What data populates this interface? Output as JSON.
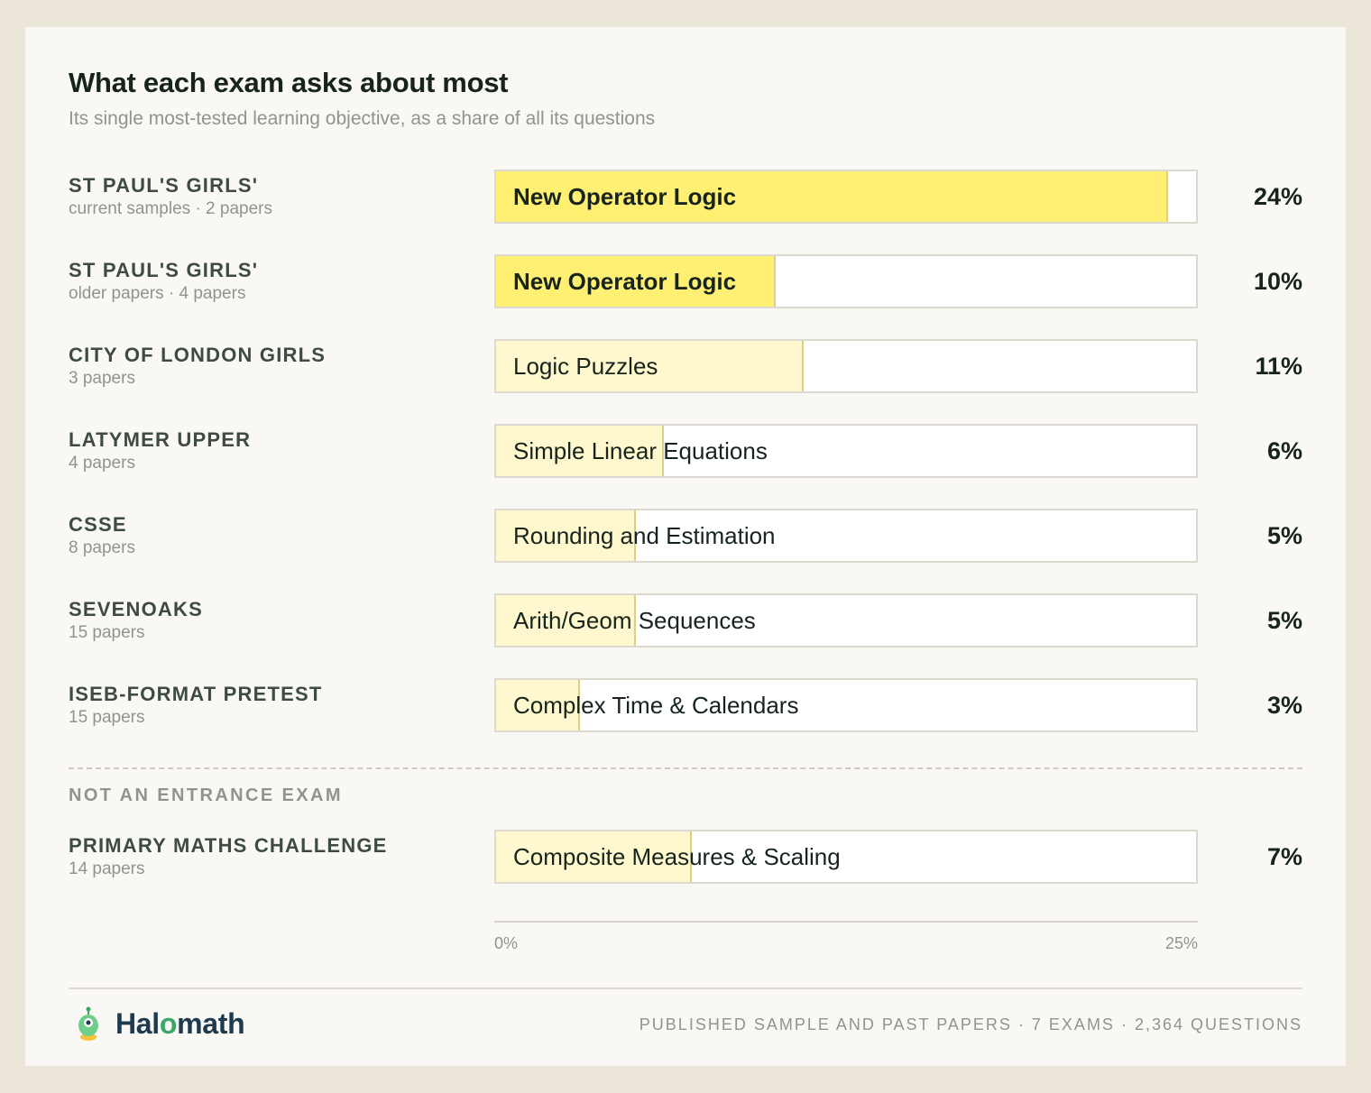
{
  "title": "What each exam asks about most",
  "subtitle": "Its single most-tested learning objective, as a share of all its questions",
  "chart_data": {
    "type": "bar",
    "orientation": "horizontal",
    "xlim": [
      0,
      25
    ],
    "x_ticks": [
      "0%",
      "25%"
    ],
    "rows": [
      {
        "exam": "ST PAUL'S GIRLS'",
        "meta": "current samples · 2 papers",
        "objective": "New Operator Logic",
        "value": 24,
        "label": "24%",
        "highlight": true
      },
      {
        "exam": "ST PAUL'S GIRLS'",
        "meta": "older papers · 4 papers",
        "objective": "New Operator Logic",
        "value": 10,
        "label": "10%",
        "highlight": true
      },
      {
        "exam": "CITY OF LONDON GIRLS",
        "meta": "3 papers",
        "objective": "Logic Puzzles",
        "value": 11,
        "label": "11%",
        "highlight": false
      },
      {
        "exam": "LATYMER UPPER",
        "meta": "4 papers",
        "objective": "Simple Linear Equations",
        "value": 6,
        "label": "6%",
        "highlight": false
      },
      {
        "exam": "CSSE",
        "meta": "8 papers",
        "objective": "Rounding and Estimation",
        "value": 5,
        "label": "5%",
        "highlight": false
      },
      {
        "exam": "SEVENOAKS",
        "meta": "15 papers",
        "objective": "Arith/Geom Sequences",
        "value": 5,
        "label": "5%",
        "highlight": false
      },
      {
        "exam": "ISEB-FORMAT PRETEST",
        "meta": "15 papers",
        "objective": "Complex Time & Calendars",
        "value": 3,
        "label": "3%",
        "highlight": false
      }
    ],
    "other_section_label": "NOT AN ENTRANCE EXAM",
    "other_rows": [
      {
        "exam": "PRIMARY MATHS CHALLENGE",
        "meta": "14 papers",
        "objective": "Composite Measures & Scaling",
        "value": 7,
        "label": "7%",
        "highlight": false
      }
    ]
  },
  "colors": {
    "highlight_fill": "#ffef72",
    "soft_fill": "#fff8cf",
    "text_dark": "#17241c",
    "text_muted": "#8f948f"
  },
  "footer": {
    "logo_icon": "robot-mascot-icon",
    "brand_name_left": "Hal",
    "brand_name_o": "o",
    "brand_name_right": "math",
    "source": "PUBLISHED SAMPLE AND PAST PAPERS · 7 EXAMS · 2,364 QUESTIONS"
  }
}
